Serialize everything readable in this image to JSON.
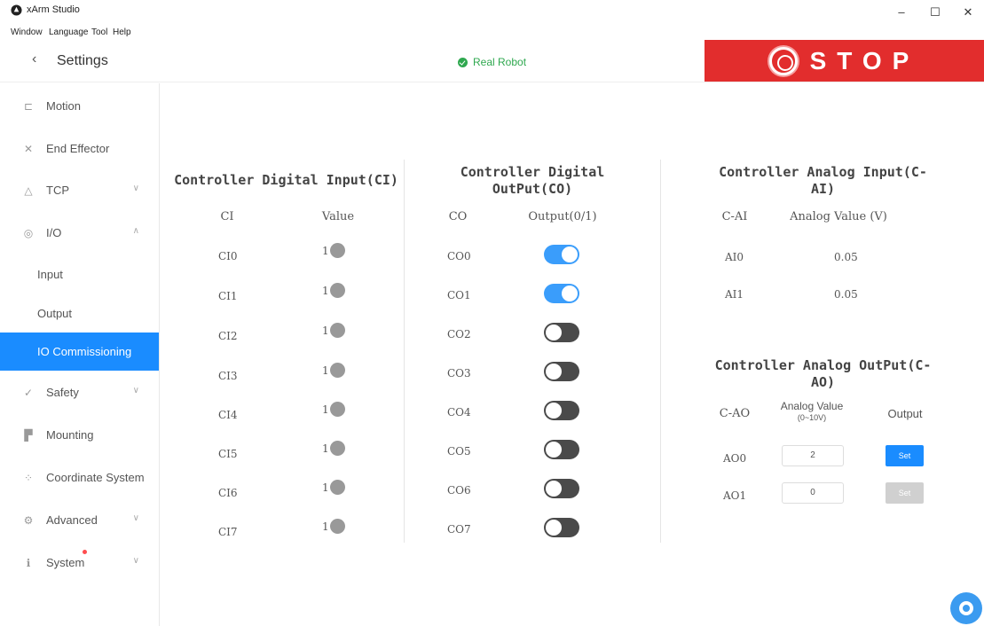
{
  "window": {
    "title": "xArm Studio",
    "minimize": "–",
    "maximize": "☐",
    "close": "✕"
  },
  "menu": [
    "Window",
    "Language",
    "Tool",
    "Help"
  ],
  "header": {
    "back": "‹",
    "title": "Settings",
    "status": "Real Robot",
    "stop": "STOP"
  },
  "sidebar": {
    "items": [
      {
        "label": "Motion",
        "icon": "motion-icon"
      },
      {
        "label": "End Effector",
        "icon": "end-effector-icon"
      },
      {
        "label": "TCP",
        "icon": "tcp-icon",
        "chevron": "∨"
      },
      {
        "label": "I/O",
        "icon": "io-icon",
        "chevron": "∧"
      },
      {
        "label": "Input"
      },
      {
        "label": "Output"
      },
      {
        "label": "IO Commissioning",
        "active": true
      },
      {
        "label": "Safety",
        "icon": "safety-icon",
        "chevron": "∨"
      },
      {
        "label": "Mounting",
        "icon": "mounting-icon"
      },
      {
        "label": "Coordinate System",
        "icon": "coordinate-icon"
      },
      {
        "label": "Advanced",
        "icon": "advanced-icon",
        "chevron": "∨"
      },
      {
        "label": "System",
        "icon": "system-icon",
        "chevron": "∨"
      }
    ]
  },
  "ci": {
    "title": "Controller Digital Input(CI)",
    "head_name": "CI",
    "head_value": "Value",
    "rows": [
      {
        "name": "CI0",
        "value": "1"
      },
      {
        "name": "CI1",
        "value": "1"
      },
      {
        "name": "CI2",
        "value": "1"
      },
      {
        "name": "CI3",
        "value": "1"
      },
      {
        "name": "CI4",
        "value": "1"
      },
      {
        "name": "CI5",
        "value": "1"
      },
      {
        "name": "CI6",
        "value": "1"
      },
      {
        "name": "CI7",
        "value": "1"
      }
    ]
  },
  "co": {
    "title_line1": "Controller Digital",
    "title_line2": "OutPut(CO)",
    "head_name": "CO",
    "head_value": "Output(0/1)",
    "rows": [
      {
        "name": "CO0",
        "on": true
      },
      {
        "name": "CO1",
        "on": true
      },
      {
        "name": "CO2",
        "on": false
      },
      {
        "name": "CO3",
        "on": false
      },
      {
        "name": "CO4",
        "on": false
      },
      {
        "name": "CO5",
        "on": false
      },
      {
        "name": "CO6",
        "on": false
      },
      {
        "name": "CO7",
        "on": false
      }
    ]
  },
  "cai": {
    "title_line1": "Controller Analog Input(C-",
    "title_line2": "AI)",
    "head_name": "C-AI",
    "head_value": "Analog Value (V)",
    "rows": [
      {
        "name": "AI0",
        "value": "0.05"
      },
      {
        "name": "AI1",
        "value": "0.05"
      }
    ]
  },
  "cao": {
    "title_line1": "Controller Analog OutPut(C-",
    "title_line2": "AO)",
    "head_name": "C-AO",
    "head_value": "Analog Value",
    "head_range": "(0~10V)",
    "head_output": "Output",
    "rows": [
      {
        "name": "AO0",
        "value": "2",
        "set": "Set",
        "enabled": true
      },
      {
        "name": "AO1",
        "value": "0",
        "set": "Set",
        "enabled": false
      }
    ]
  },
  "colors": {
    "accent": "#1a8cff",
    "stop": "#e22d2d",
    "ok": "#2fa84f",
    "toggle_on": "#3a9dfb",
    "toggle_off": "#4a4a4a"
  }
}
